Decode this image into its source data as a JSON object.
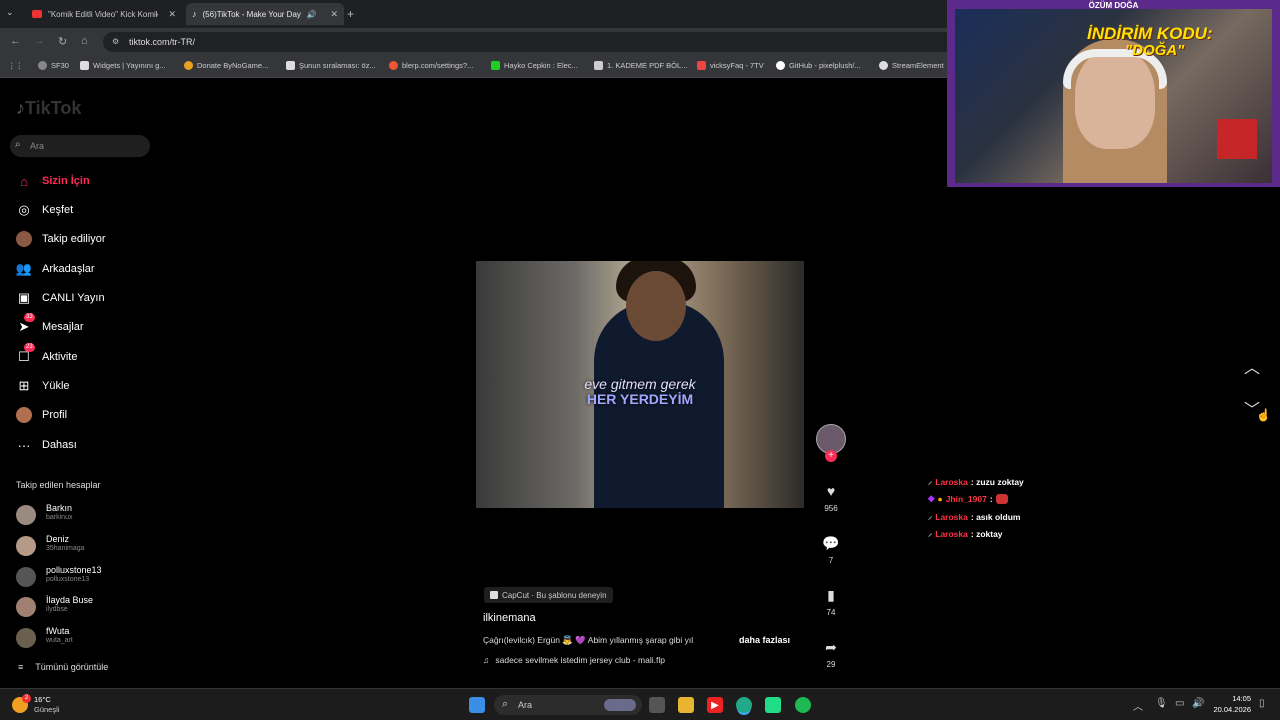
{
  "browser": {
    "tabs": [
      {
        "title": "\"Komik Editli Video\" Kick Komik"
      },
      {
        "title": "(56)TikTok - Make Your Day"
      }
    ],
    "url": "tiktok.com/tr-TR/",
    "bookmarks": [
      "SF30",
      "Widgets | Yayınını g...",
      "Donate ByNoGame...",
      "Şunun sıralaması: öz...",
      "blerp.com/settings?...",
      "Hayko Cepkin : Elec...",
      "1. KADEME PDF BÖL...",
      "vicksyFaq - 7TV",
      "GitHub - pixelplush/...",
      "StreamElement"
    ]
  },
  "tiktok": {
    "logo": "TikTok",
    "search_placeholder": "Ara",
    "nav": [
      {
        "label": "Sizin İçin",
        "icon": "home-icon",
        "active": true
      },
      {
        "label": "Keşfet",
        "icon": "compass-icon"
      },
      {
        "label": "Takip ediliyor",
        "icon": "following-avatar-icon"
      },
      {
        "label": "Arkadaşlar",
        "icon": "friends-icon"
      },
      {
        "label": "CANLI Yayın",
        "icon": "live-icon"
      },
      {
        "label": "Mesajlar",
        "icon": "messages-icon",
        "badge": "33"
      },
      {
        "label": "Aktivite",
        "icon": "activity-icon",
        "badge": "23"
      },
      {
        "label": "Yükle",
        "icon": "upload-icon"
      },
      {
        "label": "Profil",
        "icon": "profile-avatar-icon"
      },
      {
        "label": "Dahası",
        "icon": "more-icon"
      }
    ],
    "followed_heading": "Takip edilen hesaplar",
    "followed": [
      {
        "name": "Barkın",
        "handle": "barkinux"
      },
      {
        "name": "Deniz",
        "handle": "35hanimaga"
      },
      {
        "name": "polluxstone13",
        "handle": "polluxstone13"
      },
      {
        "name": "İlayda Buse",
        "handle": "ilydbse"
      },
      {
        "name": "fWuta",
        "handle": "wuta_art"
      }
    ],
    "show_all": "Tümünü görüntüle",
    "video": {
      "overlay_line1": "eve gitmem gerek",
      "overlay_line2": "HER YERDEYİM",
      "capcut": "CapCut · Bu şablonu deneyin",
      "author": "ilkinemana",
      "description": "Çağrı(levilcık) Ergün 👼 💜 Abim yıllanmış şarap gibi yıl",
      "more": "daha fazlası",
      "music": "sadece sevilmek istedim jersey club - mali.flp",
      "likes": "956",
      "comments": "7",
      "saves": "74",
      "shares": "29"
    }
  },
  "overlay": {
    "streamer": "ÖZÜM DOĞA",
    "code_line1": "İNDİRİM KODU:",
    "code_line2": "\"DOĞA\"",
    "chat": [
      {
        "user": "Laroska",
        "msg": ": zuzu zoktay"
      },
      {
        "user": "Jhin_1907",
        "msg": ":"
      },
      {
        "user": "Laroska",
        "msg": ": asık oldum"
      },
      {
        "user": "Laroska",
        "msg": ": zoktay"
      }
    ]
  },
  "taskbar": {
    "weather_temp": "16°C",
    "weather_loc": "Güneşli",
    "weather_badge": "2",
    "search": "Ara",
    "time": "14:05",
    "date": "20.04.2026"
  },
  "colors": {
    "accent": "#fe2c55",
    "overlay_frame": "#5b2a8a",
    "chat_user": "#ff3344"
  }
}
